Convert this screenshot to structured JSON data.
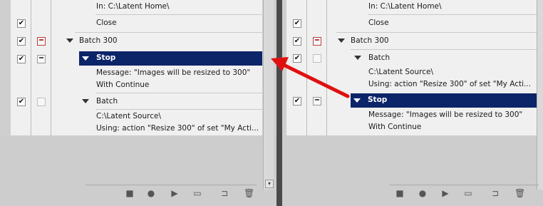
{
  "left_panel": {
    "rows": [
      {
        "id": "in",
        "text": "In: C:\\Latent Home\\"
      },
      {
        "id": "close",
        "text": "Close"
      },
      {
        "id": "batch300",
        "text": "Batch 300"
      },
      {
        "id": "stop",
        "text": "Stop"
      },
      {
        "id": "msg1",
        "text": "Message:  \"Images will be resized to 300\""
      },
      {
        "id": "msg2",
        "text": "With Continue"
      },
      {
        "id": "batch",
        "text": "Batch"
      },
      {
        "id": "src",
        "text": "C:\\Latent Source\\"
      },
      {
        "id": "using",
        "text": "Using: action \"Resize 300\" of set \"My Acti..."
      }
    ]
  },
  "right_panel": {
    "rows": [
      {
        "id": "in",
        "text": "In: C:\\Latent Home\\"
      },
      {
        "id": "close",
        "text": "Close"
      },
      {
        "id": "batch300",
        "text": "Batch 300"
      },
      {
        "id": "batch",
        "text": "Batch"
      },
      {
        "id": "src",
        "text": "C:\\Latent Source\\"
      },
      {
        "id": "using",
        "text": "Using: action \"Resize 300\" of set \"My Acti..."
      },
      {
        "id": "stop",
        "text": "Stop"
      },
      {
        "id": "msg1",
        "text": "Message:  \"Images will be resized to 300\""
      },
      {
        "id": "msg2",
        "text": "With Continue"
      }
    ]
  },
  "toolbar_icons": [
    "stop-icon",
    "record-icon",
    "play-icon",
    "new-set-icon",
    "new-action-icon",
    "trash-icon"
  ],
  "colors": {
    "selection": "#0c2468",
    "arrow": "#e01010",
    "panel": "#cfcfcf",
    "list_bg": "#f0f0f0"
  }
}
